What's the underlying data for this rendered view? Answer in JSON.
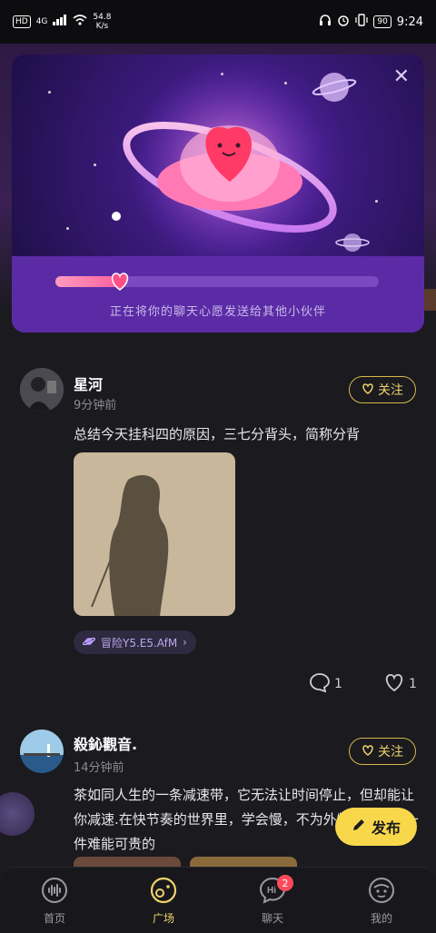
{
  "status_bar": {
    "network": "HD",
    "signal": "4G",
    "speed_value": "54.8",
    "speed_unit": "K/s",
    "battery": "90",
    "time": "9:24"
  },
  "modal": {
    "caption": "正在将你的聊天心愿发送给其他小伙伴",
    "progress": 0.2,
    "close_icon": "close-icon"
  },
  "posts": [
    {
      "username": "星河",
      "time": "9分钟前",
      "follow_label": "关注",
      "text": "总结今天挂科四的原因，三七分背头，简称分背",
      "topic": "冒险Y5.E5.AfM",
      "comments": "1",
      "likes": "1"
    },
    {
      "username": "殺鈊觀音.",
      "time": "14分钟前",
      "follow_label": "关注",
      "text": "茶如同人生的一条减速带，它无法让时间停止，但却能让你减速.在快节奏的世界里，学会慢，不为外物所动，是一件难能可贵的"
    }
  ],
  "fab": {
    "label": "发布"
  },
  "bottom_nav": {
    "items": [
      {
        "label": "首页",
        "icon": "home-voice-icon"
      },
      {
        "label": "广场",
        "icon": "plaza-icon"
      },
      {
        "label": "聊天",
        "icon": "chat-hi-icon",
        "badge": "2"
      },
      {
        "label": "我的",
        "icon": "profile-icon"
      }
    ]
  },
  "colors": {
    "accent": "#f0d26a",
    "fab": "#f8d84a",
    "modal": "#5b2ba6",
    "badge": "#ff4a5a"
  }
}
